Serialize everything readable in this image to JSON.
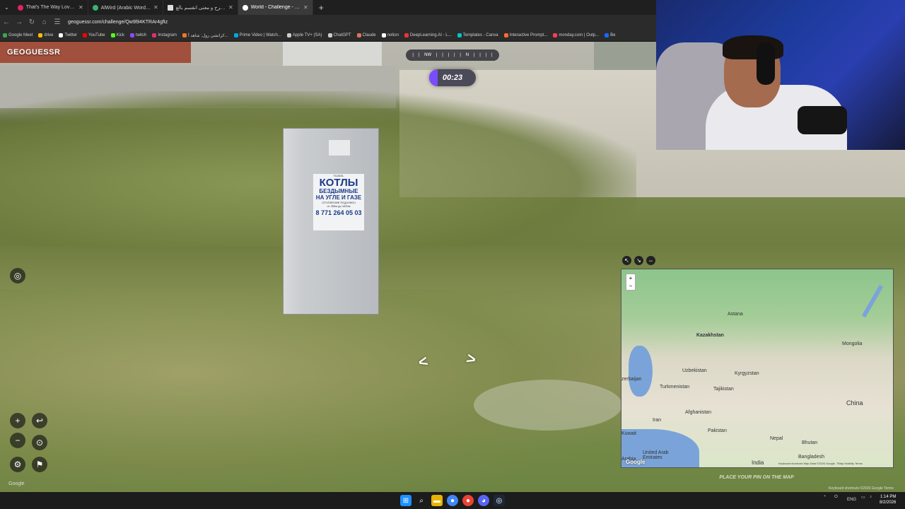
{
  "tabs": [
    {
      "title": "That's The Way Love Goes",
      "color": "#e0245e"
    },
    {
      "title": "AlWird (Arabic Wordle) - الورد",
      "color": "#3cb371"
    },
    {
      "title": "تعريف و شرح و معنى انقسم بالع",
      "color": "#dddddd"
    },
    {
      "title": "World - Challenge - GeoGu",
      "color": "#ffffff"
    }
  ],
  "address": {
    "url": "geoguessr.com/challenge/Qw9l94KTRAr4gftz"
  },
  "bookmarks": [
    {
      "label": "Google Meet",
      "color": "#34a853"
    },
    {
      "label": "drive",
      "color": "#fbbc05"
    },
    {
      "label": "Twitter",
      "color": "#ffffff"
    },
    {
      "label": "YouTube",
      "color": "#ff0000"
    },
    {
      "label": "Kick",
      "color": "#53fc18"
    },
    {
      "label": "twitch",
      "color": "#9146ff"
    },
    {
      "label": "Instagram",
      "color": "#e1306c"
    },
    {
      "label": "كرانشي رول: شاهد أ...",
      "color": "#f47521"
    },
    {
      "label": "Prime Video | Watch...",
      "color": "#00a8e1"
    },
    {
      "label": "Apple TV+ (SA)",
      "color": "#cccccc"
    },
    {
      "label": "ChatGPT",
      "color": "#cccccc"
    },
    {
      "label": "Claude",
      "color": "#d97757"
    },
    {
      "label": "notion",
      "color": "#ffffff"
    },
    {
      "label": "DeepLearning.AI - L...",
      "color": "#e33"
    },
    {
      "label": "Templates - Canva",
      "color": "#00c4cc"
    },
    {
      "label": "Interactive Prompt...",
      "color": "#ff6b35"
    },
    {
      "label": "monday.com | Outp...",
      "color": "#ff3d57"
    },
    {
      "label": "Be",
      "color": "#1769ff"
    }
  ],
  "game": {
    "logo": "GEOGUESSR",
    "timer": "00:23",
    "compass": [
      "NW",
      "N"
    ],
    "place_pin": "PLACE YOUR PIN ON THE MAP"
  },
  "sign": {
    "header": "TILBOIL",
    "big": "КОТЛЫ",
    "line1": "БЕЗДЫМНЫЕ",
    "line2": "НА УГЛЕ И ГАЗЕ",
    "line3": "ОТОПЛЕНИЕ ПОД КЛЮЧ",
    "line4": "от 250м до 1000м",
    "phone": "8 771 264 05 03"
  },
  "map": {
    "labels": [
      "Kazakhstan",
      "Mongolia",
      "Uzbekistan",
      "Kyrgyzstan",
      "zerbaijan",
      "Turkmenistan",
      "Tajikistan",
      "China",
      "Afghanistan",
      "Iran",
      "Pakistan",
      "Nepal",
      "Bhutan",
      "Kuwait",
      "United Arab Emirates",
      "India",
      "Bangladesh",
      "Astana",
      "Arabia"
    ],
    "footer": "Keyboard shortcuts  Map Data ©2026 Google, TMap Mobility  Terms",
    "google": "Google"
  },
  "footer": {
    "shortcuts": "Keyboard shortcuts  ©2026 Google  Terms",
    "google": "Google"
  },
  "taskbar": {
    "lang": "ENG",
    "time": "1:14 PM",
    "date": "8/2/2026"
  }
}
